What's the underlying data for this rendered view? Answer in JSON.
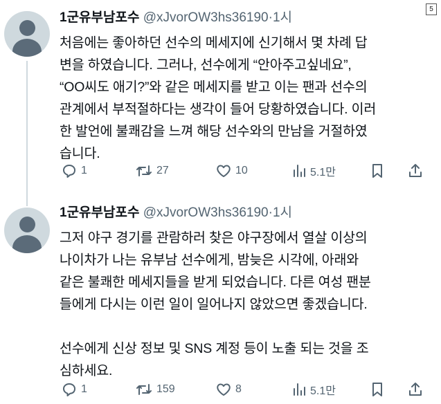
{
  "corner_badge": "5",
  "tweets": [
    {
      "name": "1군유부남포수",
      "handle": "@xJvorOW3hs36190",
      "dot": "·",
      "time": "1시",
      "text": "처음에는 좋아하던 선수의 메세지에 신기해서 몇 차례 답\n변을 하였습니다. 그러나, 선수에게 “안아주고싶네요”,\n“OO씨도 애기?”와 같은 메세지를 받고 이는 팬과 선수의\n관계에서 부적절하다는 생각이 들어 당황하였습니다. 이러\n한 발언에 불쾌감을 느껴 해당 선수와의 만남을 거절하였\n습니다.",
      "replies": "1",
      "retweets": "27",
      "likes": "10",
      "views": "5.1만"
    },
    {
      "name": "1군유부남포수",
      "handle": "@xJvorOW3hs36190",
      "dot": "·",
      "time": "1시",
      "text": "그저 야구 경기를 관람하러 찾은 야구장에서 열살 이상의\n나이차가 나는 유부남 선수에게, 밤늦은 시각에, 아래와\n같은 불쾌한 메세지들을 받게 되었습니다. 다른 여성 팬분\n들에게 다시는 이런 일이 일어나지 않았으면 좋겠습니다.\n\n선수에게 신상 정보 및 SNS 계정 등이 노출 되는 것을 조\n심하세요.",
      "replies": "1",
      "retweets": "159",
      "likes": "8",
      "views": "5.1만"
    }
  ],
  "icons": {
    "reply": "speech-bubble-icon",
    "retweet": "retweet-arrows-icon",
    "like": "heart-icon",
    "views": "bar-chart-icon",
    "bookmark": "bookmark-icon",
    "share": "share-upload-icon"
  }
}
